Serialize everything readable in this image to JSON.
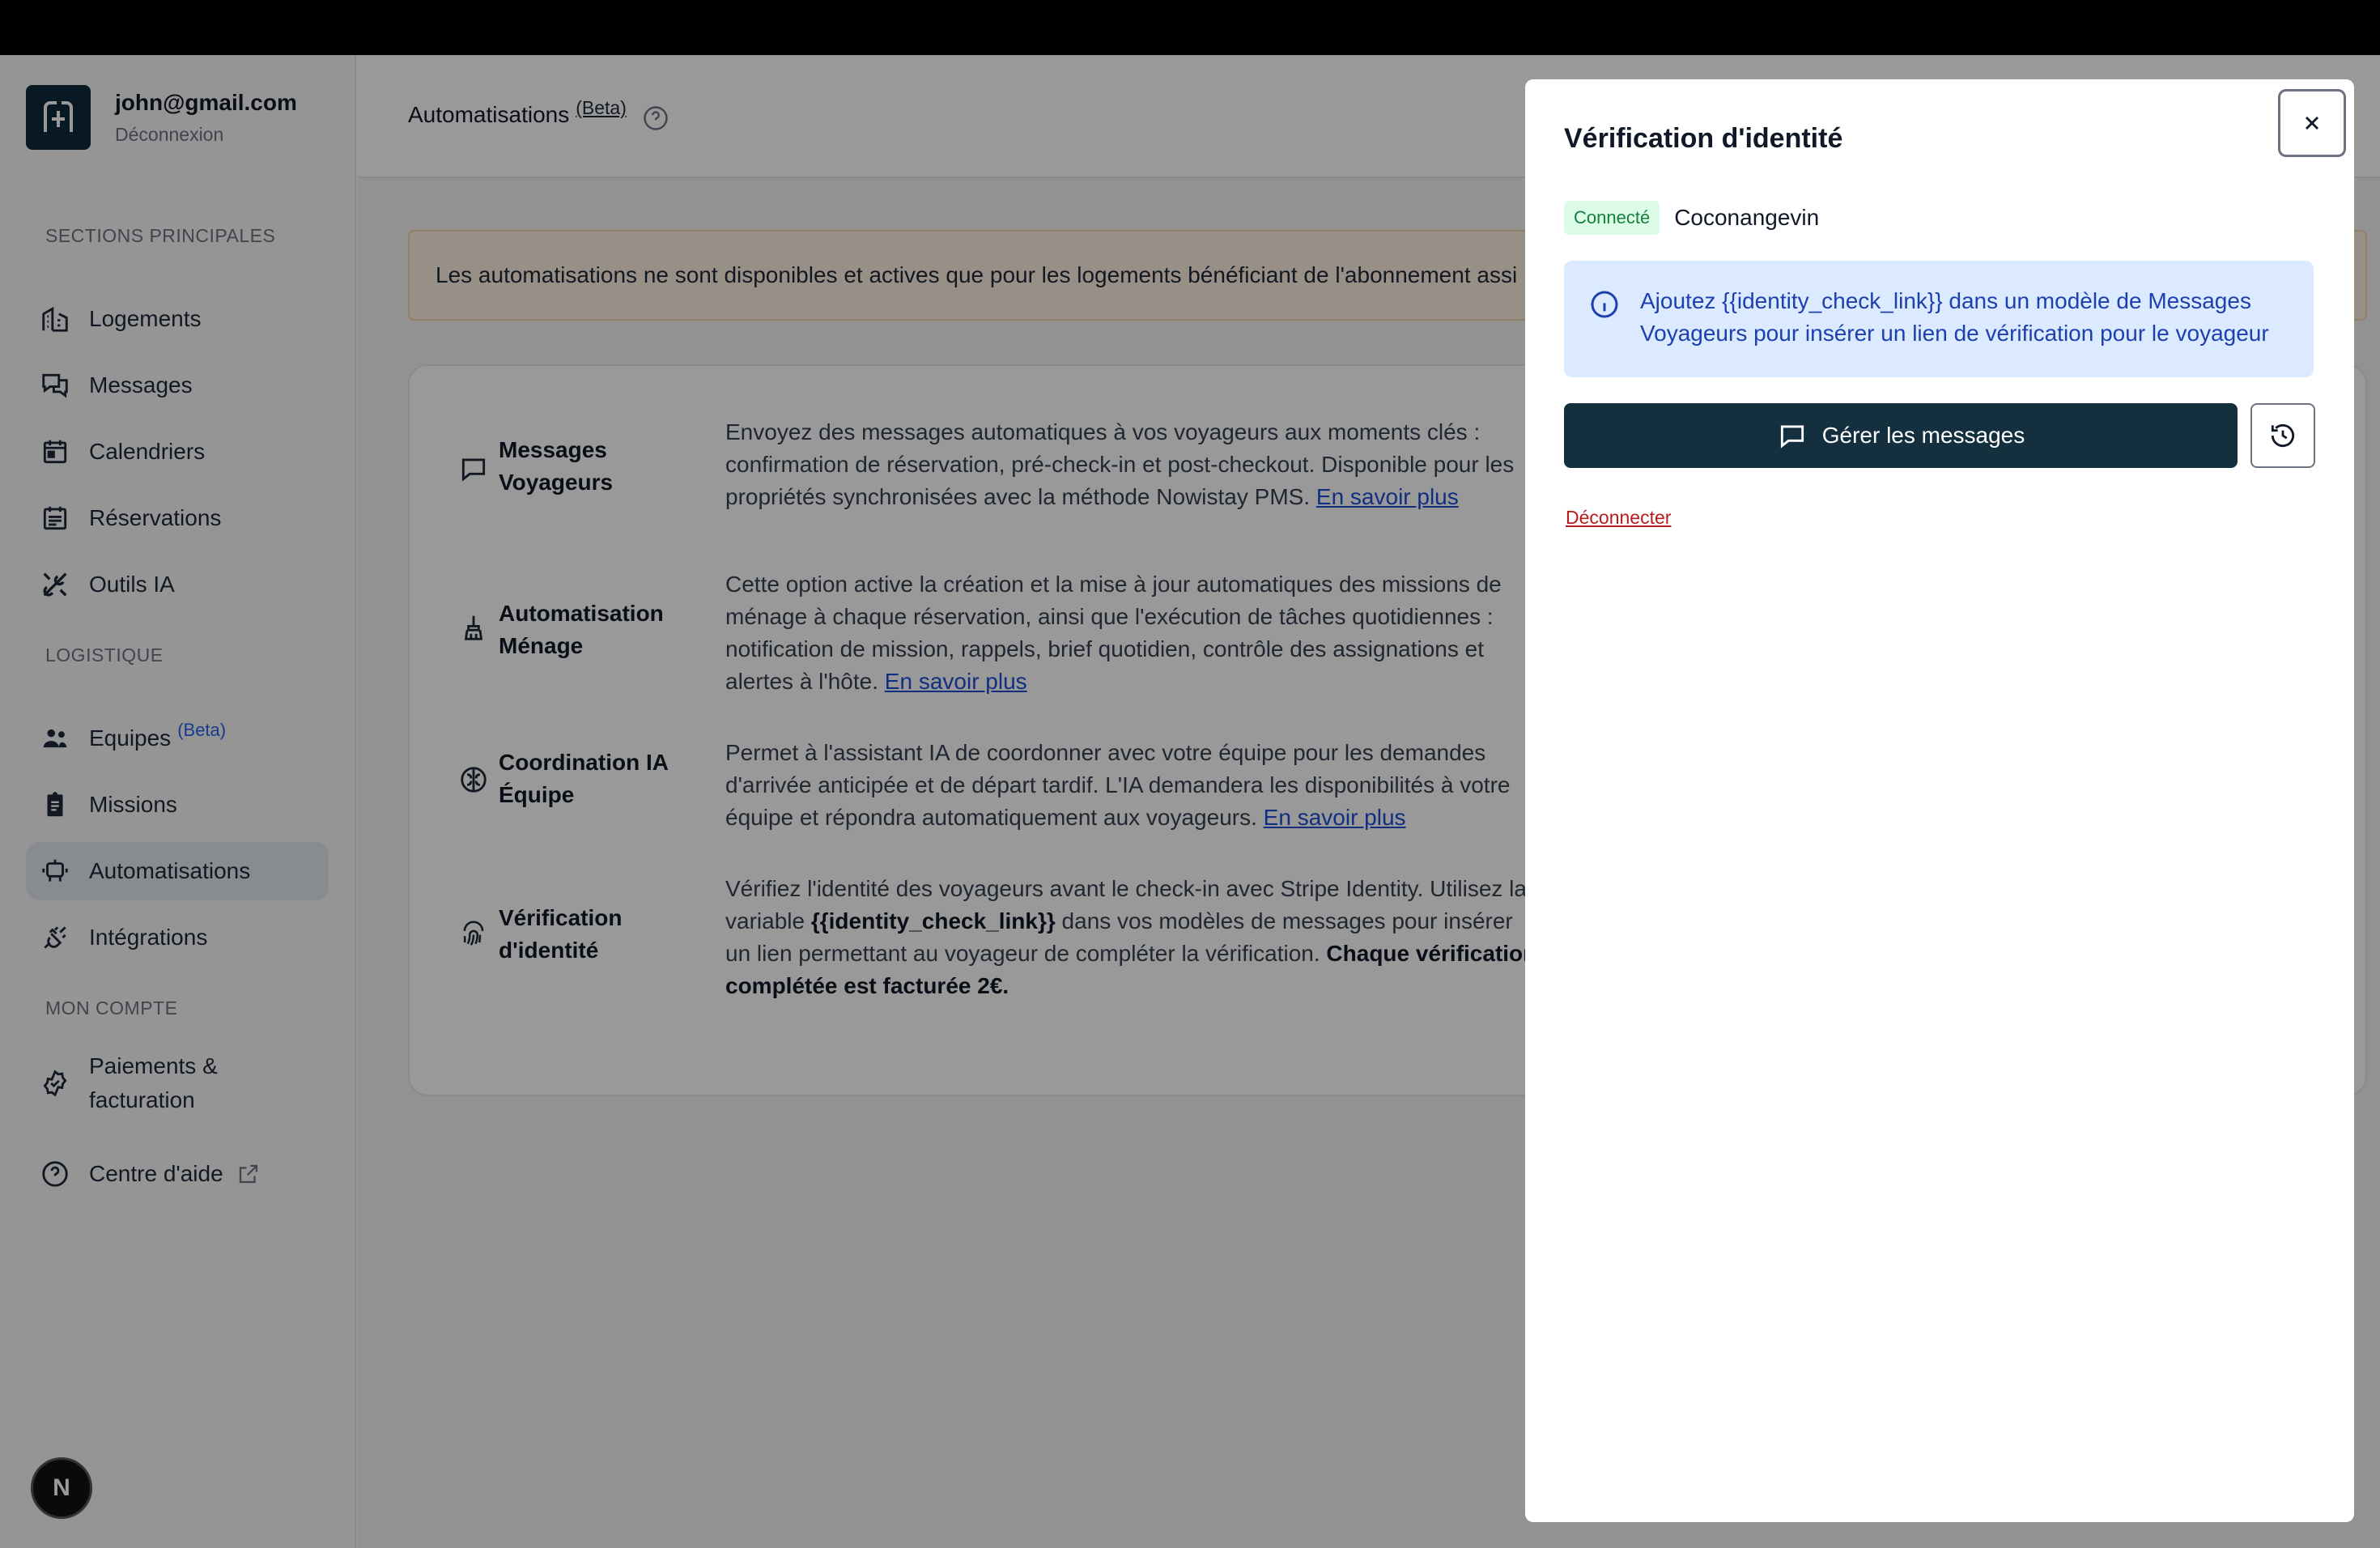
{
  "user": {
    "email": "john@gmail.com",
    "logout": "Déconnexion"
  },
  "sidebar": {
    "sections": [
      {
        "title": "SECTIONS PRINCIPALES"
      },
      {
        "title": "LOGISTIQUE"
      },
      {
        "title": "MON COMPTE"
      }
    ],
    "items": [
      {
        "label": "Logements",
        "icon": "building-icon"
      },
      {
        "label": "Messages",
        "icon": "chat-icon"
      },
      {
        "label": "Calendriers",
        "icon": "calendar-icon"
      },
      {
        "label": "Réservations",
        "icon": "list-icon"
      },
      {
        "label": "Outils IA",
        "icon": "tools-icon"
      },
      {
        "label": "Equipes",
        "icon": "team-icon",
        "badge": "(Beta)"
      },
      {
        "label": "Missions",
        "icon": "clipboard-icon"
      },
      {
        "label": "Automatisations",
        "icon": "robot-icon",
        "active": true
      },
      {
        "label": "Intégrations",
        "icon": "plug-icon"
      },
      {
        "label_line1": "Paiements &",
        "label_line2": "facturation",
        "icon": "badge-check-icon"
      },
      {
        "label": "Centre d'aide",
        "icon": "help-icon"
      }
    ],
    "bottom_badge": "N"
  },
  "header": {
    "title": "Automatisations",
    "beta": "(Beta)"
  },
  "alert": {
    "text": "Les automatisations ne sont disponibles et actives que pour les logements bénéficiant de l'abonnement assi"
  },
  "automations": [
    {
      "title_line1": "Messages",
      "title_line2": "Voyageurs",
      "desc": "Envoyez des messages automatiques à vos voyageurs aux moments clés : confirmation de réservation, pré-check-in et post-checkout. Disponible pour les propriétés synchronisées avec la méthode Nowistay PMS.",
      "link": "En savoir plus"
    },
    {
      "title_line1": "Automatisation",
      "title_line2": "Ménage",
      "desc": "Cette option active la création et la mise à jour automatiques des missions de ménage à chaque réservation, ainsi que l'exécution de tâches quotidiennes : notification de mission, rappels, brief quotidien, contrôle des assignations et alertes à l'hôte.",
      "link": "En savoir plus"
    },
    {
      "title_line1": "Coordination IA",
      "title_line2": "Équipe",
      "desc": "Permet à l'assistant IA de coordonner avec votre équipe pour les demandes d'arrivée anticipée et de départ tardif. L'IA demandera les disponibilités à votre équipe et répondra automatiquement aux voyageurs.",
      "link": "En savoir plus"
    },
    {
      "title_line1": "Vérification",
      "title_line2": "d'identité",
      "desc_part1": "Vérifiez l'identité des voyageurs avant le check-in avec Stripe Identity. Utilisez la variable",
      "desc_var": "{{identity_check_link}}",
      "desc_part2": "dans vos modèles de messages pour insérer un lien permettant au voyageur de compléter la vérification.",
      "desc_bold": "Chaque vérification complétée est facturée 2€."
    }
  ],
  "drawer": {
    "title": "Vérification d'identité",
    "status": "Connecté",
    "account": "Coconangevin",
    "info": "Ajoutez {{identity_check_link}} dans un modèle de Messages Voyageurs pour insérer un lien de vérification pour le voyageur",
    "manage_button": "Gérer les messages",
    "disconnect": "Déconnecter"
  }
}
